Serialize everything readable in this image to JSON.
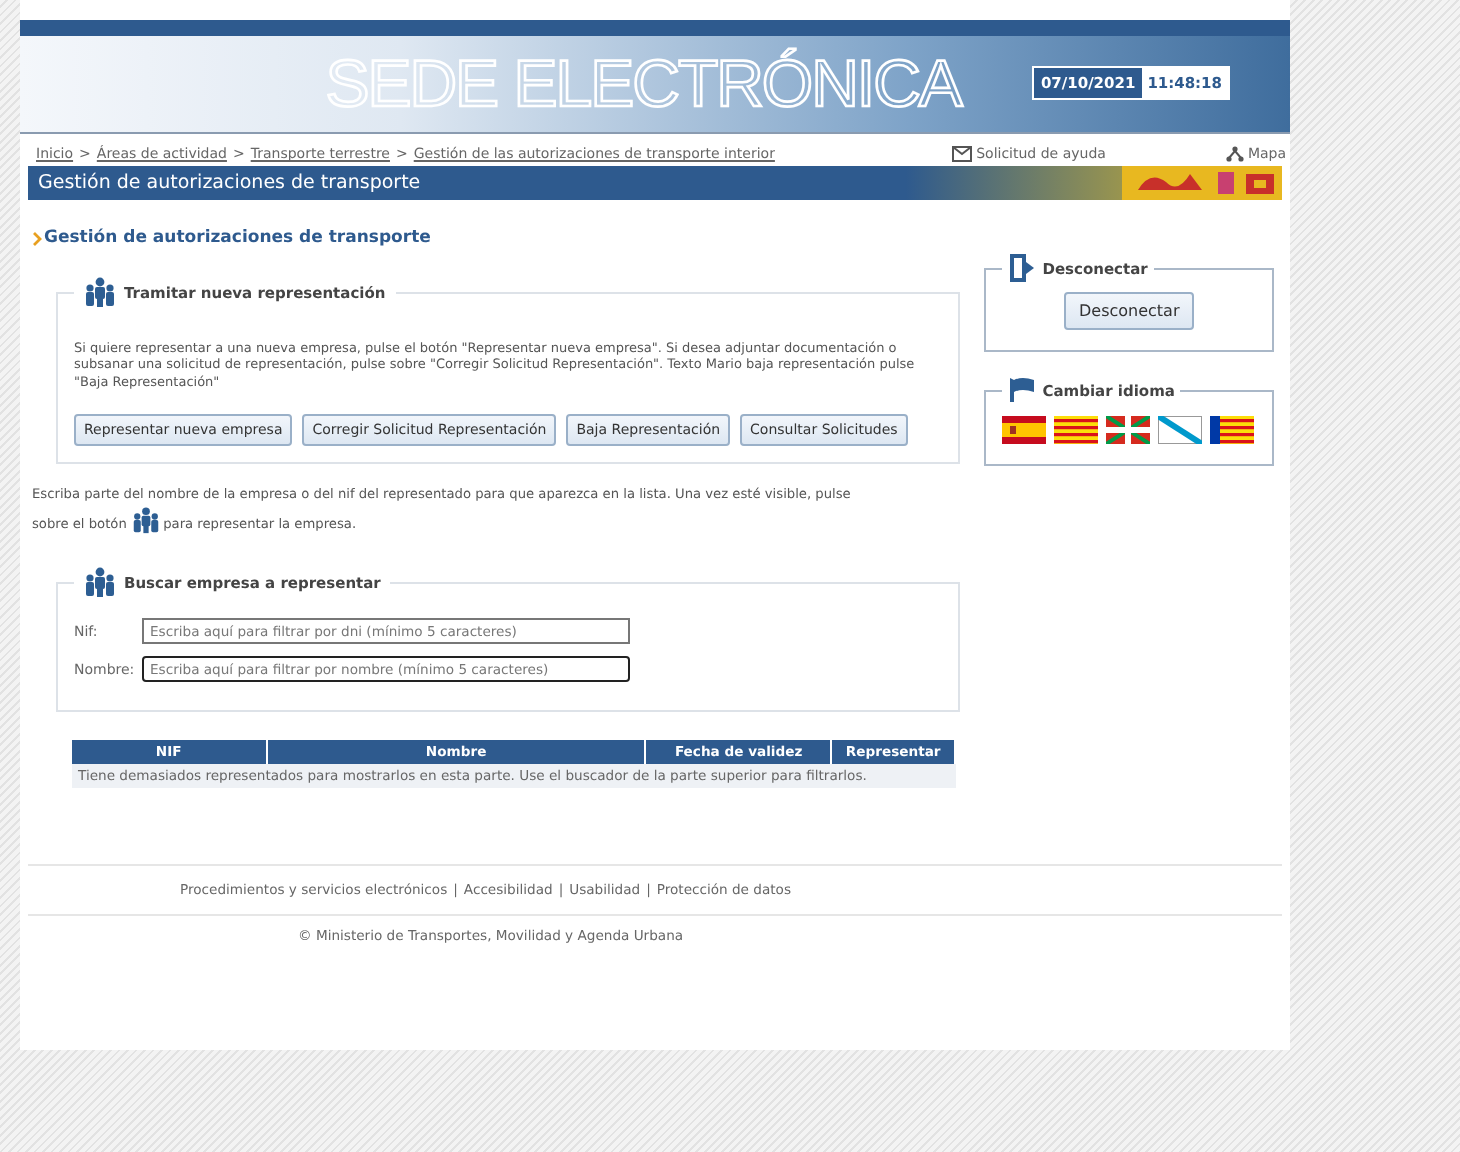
{
  "header": {
    "logo": "SEDE ELECTRÓNICA",
    "date": "07/10/2021",
    "time": "11:48:18"
  },
  "breadcrumb": {
    "separator": ">",
    "items": [
      "Inicio",
      "Áreas de actividad",
      "Transporte terrestre",
      "Gestión de las autorizaciones de transporte interior"
    ]
  },
  "top_links": [
    "Solicitud de ayuda",
    "Mapa"
  ],
  "title_bar": "Gestión de autorizaciones de transporte",
  "page_heading": "Gestión de autorizaciones de transporte",
  "tramitar": {
    "legend": "Tramitar nueva representación",
    "text": "Si quiere representar a una nueva empresa, pulse el botón \"Representar nueva empresa\". Si desea adjuntar documentación o subsanar una solicitud de representación, pulse sobre \"Corregir Solicitud Representación\". Texto Mario baja representación pulse \"Baja Representación\"",
    "buttons": [
      "Representar nueva empresa",
      "Corregir Solicitud Representación",
      "Baja Representación",
      "Consultar Solicitudes"
    ]
  },
  "instructions": {
    "line": "Escriba parte del nombre de la empresa o del nif del representado para que aparezca en la lista. Una vez esté visible, pulse",
    "before": "sobre el botón",
    "after": "para representar la empresa."
  },
  "buscar": {
    "legend": "Buscar empresa a representar",
    "fields": [
      {
        "label": "Nif:",
        "placeholder": "Escriba aquí para filtrar por dni (mínimo 5 caracteres)",
        "focused": false
      },
      {
        "label": "Nombre:",
        "placeholder": "Escriba aquí para filtrar por nombre (mínimo 5 caracteres)",
        "focused": true
      }
    ]
  },
  "table": {
    "columns": [
      "NIF",
      "Nombre",
      "Fecha de validez",
      "Representar"
    ],
    "message": "Tiene demasiados representados para mostrarlos en esta parte. Use el buscador de la parte superior para filtrarlos."
  },
  "desconectar": {
    "legend": "Desconectar",
    "button": "Desconectar"
  },
  "idioma": {
    "legend": "Cambiar idioma",
    "flags": [
      {
        "kind": "spain"
      },
      {
        "kind": "catalonia"
      },
      {
        "kind": "basque"
      },
      {
        "kind": "galicia"
      },
      {
        "kind": "valencia"
      }
    ]
  },
  "footer": {
    "separator": "|",
    "links": [
      "Procedimientos y servicios electrónicos",
      "Accesibilidad",
      "Usabilidad",
      "Protección de datos"
    ],
    "copyright": "© Ministerio de Transportes, Movilidad y Agenda Urbana"
  }
}
